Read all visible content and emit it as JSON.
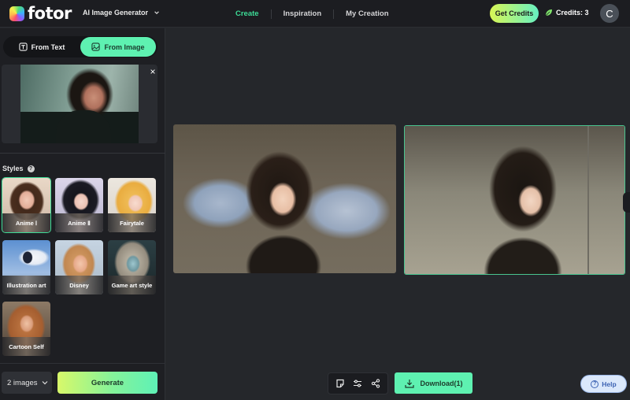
{
  "header": {
    "brand": "fotor",
    "product": "AI Image Generator",
    "nav": [
      {
        "label": "Create",
        "active": true
      },
      {
        "label": "Inspiration",
        "active": false
      },
      {
        "label": "My Creation",
        "active": false
      }
    ],
    "get_credits_label": "Get Credits",
    "credits_label": "Credits: 3",
    "avatar_initial": "C"
  },
  "sidebar": {
    "mode_tabs": [
      {
        "label": "From Text",
        "active": false
      },
      {
        "label": "From Image",
        "active": true
      }
    ],
    "upload_close": "×",
    "styles_title": "Styles",
    "styles_help": "?",
    "styles": [
      {
        "label": "Anime Ⅰ",
        "selected": true
      },
      {
        "label": "Anime Ⅱ",
        "selected": false
      },
      {
        "label": "Fairytale",
        "selected": false
      },
      {
        "label": "Illustration art",
        "selected": false
      },
      {
        "label": "Disney",
        "selected": false
      },
      {
        "label": "Game art style",
        "selected": false
      },
      {
        "label": "Cartoon Self",
        "selected": false
      }
    ],
    "image_count": "2 images",
    "generate_label": "Generate"
  },
  "main": {
    "download_label": "Download(1)",
    "help_label": "Help",
    "colors": {
      "accent": "#5ef1b1",
      "active_nav": "#3ddc97",
      "selection_border": "#49c48f"
    }
  }
}
